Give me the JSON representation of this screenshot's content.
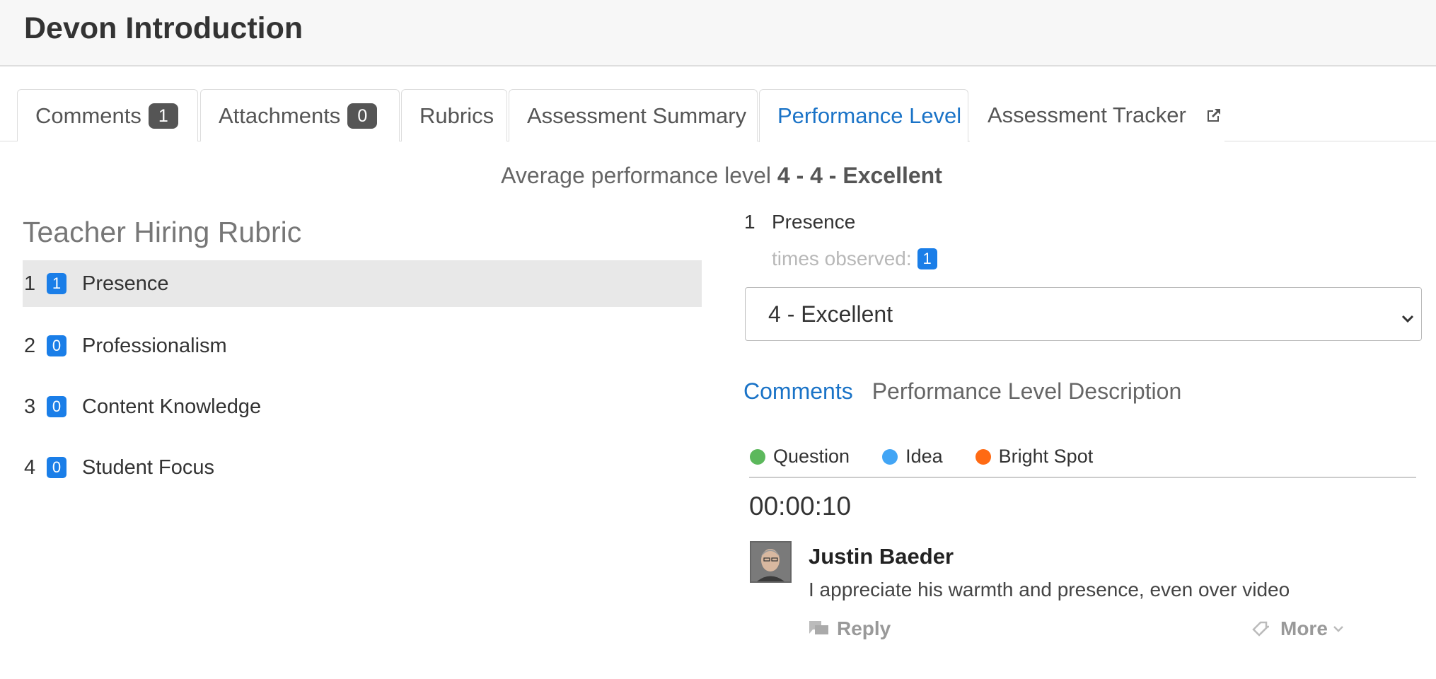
{
  "header": {
    "title": "Devon Introduction"
  },
  "tabs": [
    {
      "label": "Comments",
      "count": "1"
    },
    {
      "label": "Attachments",
      "count": "0"
    },
    {
      "label": "Rubrics"
    },
    {
      "label": "Assessment Summary"
    },
    {
      "label": "Performance Level"
    },
    {
      "label": "Assessment Tracker"
    }
  ],
  "summary": {
    "prefix": "Average performance level ",
    "value": "4 - 4 - Excellent"
  },
  "rubric": {
    "title": "Teacher Hiring Rubric",
    "criteria": [
      {
        "num": "1",
        "count": "1",
        "label": "Presence"
      },
      {
        "num": "2",
        "count": "0",
        "label": "Professionalism"
      },
      {
        "num": "3",
        "count": "0",
        "label": "Content Knowledge"
      },
      {
        "num": "4",
        "count": "0",
        "label": "Student Focus"
      }
    ]
  },
  "detail": {
    "num": "1",
    "label": "Presence",
    "times_label": "times observed:",
    "times_count": "1",
    "selected_level": "4 - Excellent",
    "subtabs": [
      "Comments",
      "Performance Level Description"
    ]
  },
  "legend": [
    {
      "label": "Question",
      "color": "#5cb85c"
    },
    {
      "label": "Idea",
      "color": "#42a5f5"
    },
    {
      "label": "Bright Spot",
      "color": "#ff6a13"
    }
  ],
  "comment": {
    "timestamp": "00:00:10",
    "author": "Justin Baeder",
    "text": "I appreciate his warmth and presence, even over video",
    "reply_label": "Reply",
    "more_label": "More"
  }
}
